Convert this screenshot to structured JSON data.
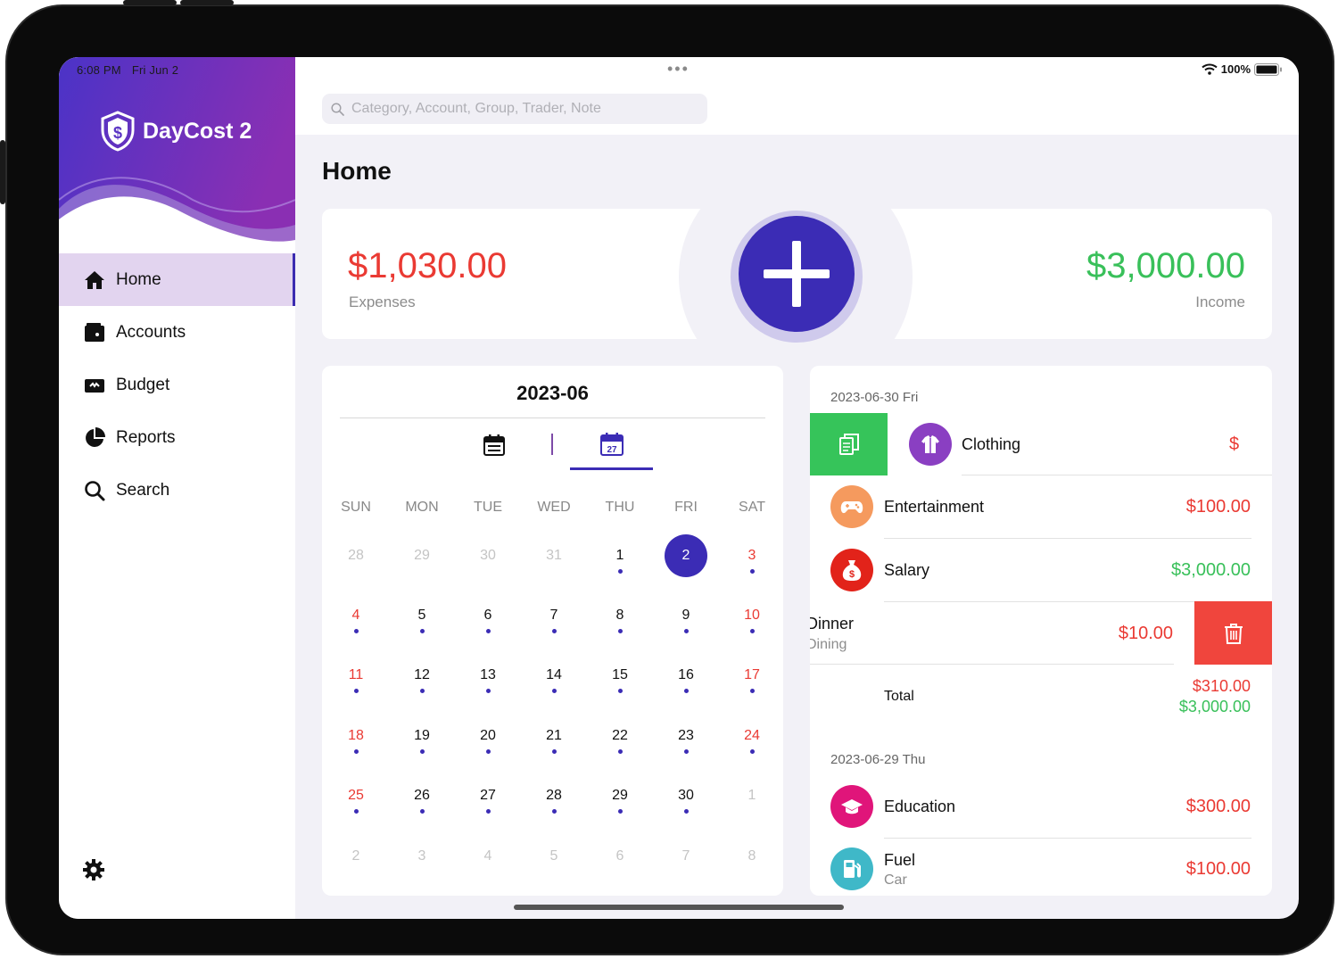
{
  "status": {
    "time": "6:08 PM",
    "date": "Fri Jun 2",
    "battery": "100%"
  },
  "app": {
    "name": "DayCost 2"
  },
  "nav": [
    {
      "label": "Home",
      "icon": "home-icon",
      "active": true
    },
    {
      "label": "Accounts",
      "icon": "wallet-icon",
      "active": false
    },
    {
      "label": "Budget",
      "icon": "budget-icon",
      "active": false
    },
    {
      "label": "Reports",
      "icon": "pie-chart-icon",
      "active": false
    },
    {
      "label": "Search",
      "icon": "search-icon",
      "active": false
    }
  ],
  "search": {
    "placeholder": "Category, Account, Group, Trader, Note"
  },
  "page": {
    "title": "Home"
  },
  "summary": {
    "expenses_amount": "$1,030.00",
    "expenses_label": "Expenses",
    "income_amount": "$3,000.00",
    "income_label": "Income"
  },
  "calendar": {
    "title": "2023-06",
    "weekdays": [
      "SUN",
      "MON",
      "TUE",
      "WED",
      "THU",
      "FRI",
      "SAT"
    ],
    "weeks": [
      [
        "28",
        "29",
        "30",
        "31",
        "1",
        "2",
        "3"
      ],
      [
        "4",
        "5",
        "6",
        "7",
        "8",
        "9",
        "10"
      ],
      [
        "11",
        "12",
        "13",
        "14",
        "15",
        "16",
        "17"
      ],
      [
        "18",
        "19",
        "20",
        "21",
        "22",
        "23",
        "24"
      ],
      [
        "25",
        "26",
        "27",
        "28",
        "29",
        "30",
        "1"
      ],
      [
        "2",
        "3",
        "4",
        "5",
        "6",
        "7",
        "8"
      ]
    ],
    "selected_day": "2",
    "icon_day": "27"
  },
  "transactions": {
    "groups": [
      {
        "date": "2023-06-30 Fri",
        "items": [
          {
            "name": "Clothing",
            "amount": "$",
            "type": "expense",
            "icon": "clothing-icon",
            "color": "#8a3fc2"
          },
          {
            "name": "Entertainment",
            "amount": "$100.00",
            "type": "expense",
            "icon": "gamepad-icon",
            "color": "#f59a5e"
          },
          {
            "name": "Salary",
            "amount": "$3,000.00",
            "type": "income",
            "icon": "money-bag-icon",
            "color": "#e2231a"
          },
          {
            "name": "Dinner",
            "sub": "Dining",
            "amount": "$10.00",
            "type": "expense"
          }
        ],
        "total_label": "Total",
        "total_expense": "$310.00",
        "total_income": "$3,000.00"
      },
      {
        "date": "2023-06-29 Thu",
        "items": [
          {
            "name": "Education",
            "amount": "$300.00",
            "type": "expense",
            "icon": "graduation-cap-icon",
            "color": "#e0157a"
          },
          {
            "name": "Fuel",
            "sub": "Car",
            "amount": "$100.00",
            "type": "expense",
            "icon": "fuel-pump-icon",
            "color": "#3fb8c8"
          }
        ]
      }
    ]
  },
  "colors": {
    "accent": "#3b2cb5",
    "expense": "#ea3a33",
    "income": "#39c05a",
    "sidebar_active": "#e2d4ef",
    "copy": "#36c45a",
    "delete": "#f0453d"
  }
}
